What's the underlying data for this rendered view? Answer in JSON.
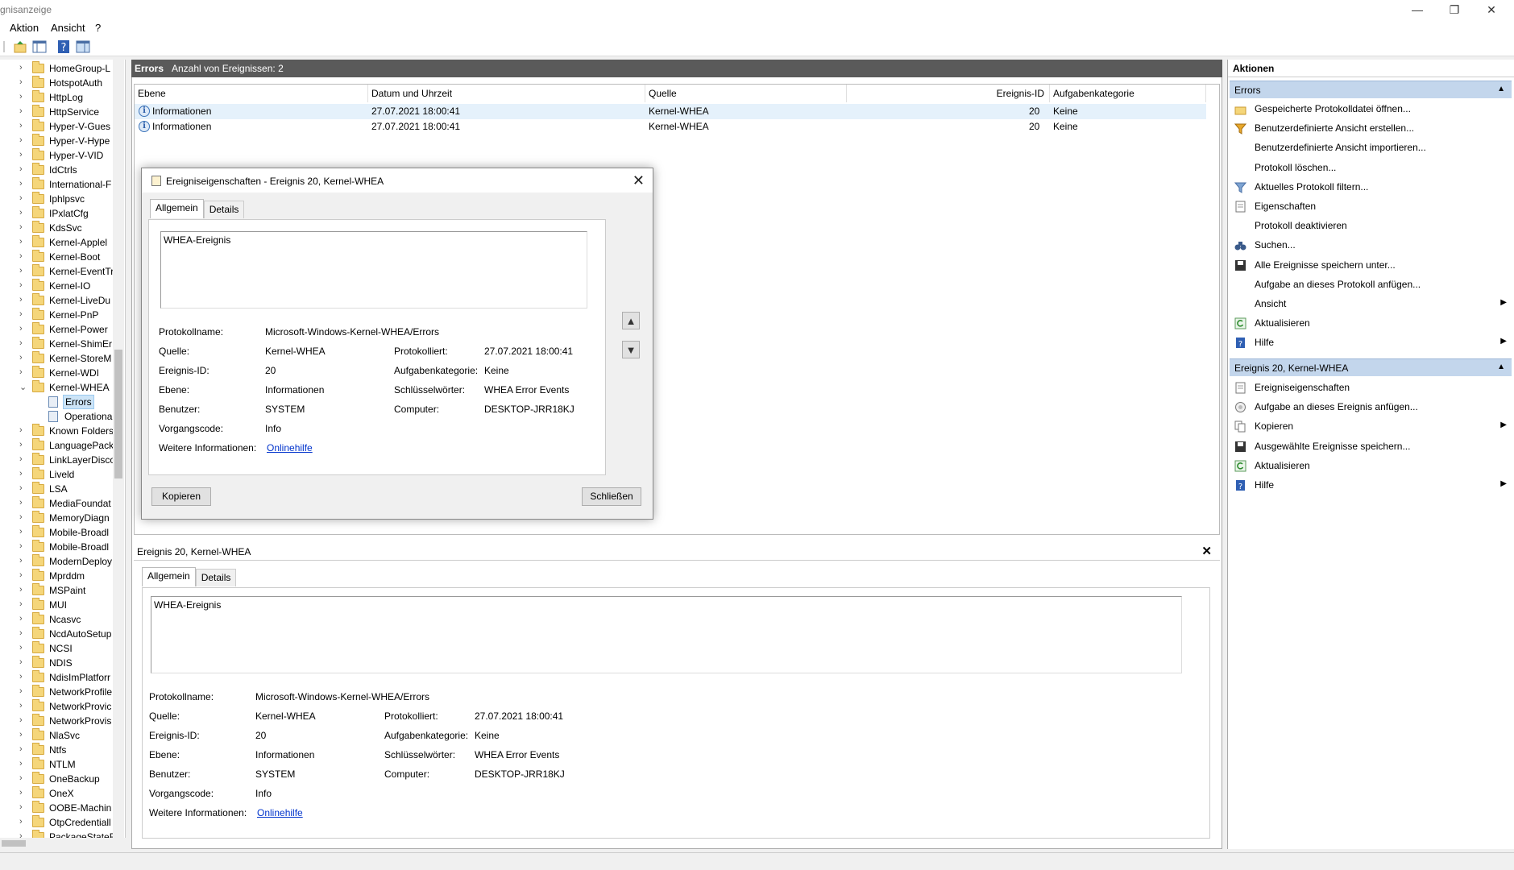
{
  "window": {
    "title": "gnisanzeige",
    "minimize": "—",
    "restore": "❐",
    "close": "✕"
  },
  "menu": [
    "Aktion",
    "Ansicht",
    "?"
  ],
  "tree": {
    "items": [
      "HomeGroup-L",
      "HotspotAuth",
      "HttpLog",
      "HttpService",
      "Hyper-V-Gues",
      "Hyper-V-Hype",
      "Hyper-V-VID",
      "IdCtrls",
      "International-F",
      "Iphlpsvc",
      "IPxlatCfg",
      "KdsSvc",
      "Kernel-Applel",
      "Kernel-Boot",
      "Kernel-EventTr",
      "Kernel-IO",
      "Kernel-LiveDu",
      "Kernel-PnP",
      "Kernel-Power",
      "Kernel-ShimEr",
      "Kernel-StoreM",
      "Kernel-WDI",
      "Kernel-WHEA"
    ],
    "whea_children": [
      "Errors",
      "Operationa"
    ],
    "items_after": [
      "Known Folders",
      "LanguagePack",
      "LinkLayerDisco",
      "Liveld",
      "LSA",
      "MediaFoundat",
      "MemoryDiagn",
      "Mobile-Broadl",
      "Mobile-Broadl",
      "ModernDeploy",
      "Mprddm",
      "MSPaint",
      "MUI",
      "Ncasvc",
      "NcdAutoSetup",
      "NCSI",
      "NDIS",
      "NdisImPlatforr",
      "NetworkProfile",
      "NetworkProvic",
      "NetworkProvis",
      "NlaSvc",
      "Ntfs",
      "NTLM",
      "OneBackup",
      "OneX",
      "OOBE-Machin",
      "OtpCredentiall",
      "PackageStateR"
    ]
  },
  "log": {
    "name": "Errors",
    "count_label": "Anzahl von Ereignissen: 2",
    "columns": [
      "Ebene",
      "Datum und Uhrzeit",
      "Quelle",
      "Ereignis-ID",
      "Aufgabenkategorie"
    ],
    "rows": [
      {
        "level": "Informationen",
        "date": "27.07.2021 18:00:41",
        "source": "Kernel-WHEA",
        "id": "20",
        "category": "Keine"
      },
      {
        "level": "Informationen",
        "date": "27.07.2021 18:00:41",
        "source": "Kernel-WHEA",
        "id": "20",
        "category": "Keine"
      }
    ]
  },
  "dialog": {
    "title": "Ereigniseigenschaften - Ereignis 20, Kernel-WHEA",
    "tab_general": "Allgemein",
    "tab_details": "Details",
    "copy_button": "Kopieren",
    "close_button": "Schließen"
  },
  "event": {
    "description": "WHEA-Ereignis",
    "labels": {
      "logname": "Protokollname:",
      "source": "Quelle:",
      "event_id": "Ereignis-ID:",
      "level": "Ebene:",
      "user": "Benutzer:",
      "opcode": "Vorgangscode:",
      "more_info": "Weitere Informationen:",
      "logged": "Protokolliert:",
      "task_category": "Aufgabenkategorie:",
      "keywords": "Schlüsselwörter:",
      "computer": "Computer:"
    },
    "values": {
      "logname": "Microsoft-Windows-Kernel-WHEA/Errors",
      "source": "Kernel-WHEA",
      "event_id": "20",
      "level": "Informationen",
      "user": "SYSTEM",
      "opcode": "Info",
      "more_info": "Onlinehilfe",
      "logged": "27.07.2021 18:00:41",
      "task_category": "Keine",
      "keywords": "WHEA Error Events",
      "computer": "DESKTOP-JRR18KJ"
    }
  },
  "preview": {
    "title": "Ereignis 20, Kernel-WHEA",
    "tab_general": "Allgemein",
    "tab_details": "Details"
  },
  "actions": {
    "title": "Aktionen",
    "section1": "Errors",
    "section1_items": [
      "Gespeicherte Protokolldatei öffnen...",
      "Benutzerdefinierte Ansicht erstellen...",
      "Benutzerdefinierte Ansicht importieren...",
      "Protokoll löschen...",
      "Aktuelles Protokoll filtern...",
      "Eigenschaften",
      "Protokoll deaktivieren",
      "Suchen...",
      "Alle Ereignisse speichern unter...",
      "Aufgabe an dieses Protokoll anfügen...",
      "Ansicht",
      "Aktualisieren",
      "Hilfe"
    ],
    "section2": "Ereignis 20, Kernel-WHEA",
    "section2_items": [
      "Ereigniseigenschaften",
      "Aufgabe an dieses Ereignis anfügen...",
      "Kopieren",
      "Ausgewählte Ereignisse speichern...",
      "Aktualisieren",
      "Hilfe"
    ]
  }
}
